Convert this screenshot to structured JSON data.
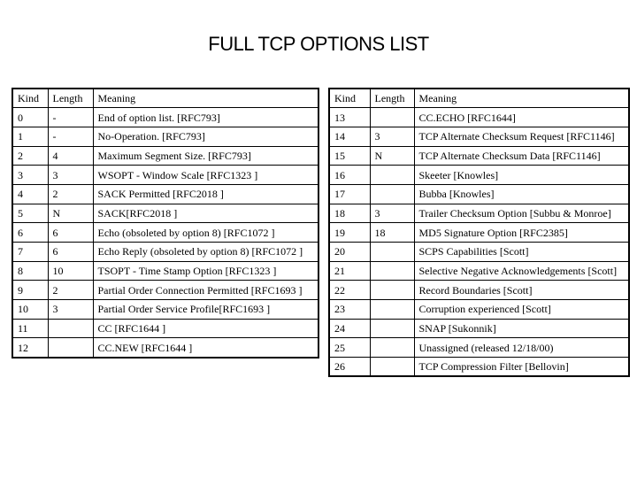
{
  "title": "FULL TCP OPTIONS LIST",
  "headers": {
    "kind": "Kind",
    "length": "Length",
    "meaning": "Meaning"
  },
  "left_table": [
    {
      "kind": "0",
      "length": "-",
      "meaning": "End of option list. [RFC793]"
    },
    {
      "kind": "1",
      "length": "-",
      "meaning": "No-Operation. [RFC793]"
    },
    {
      "kind": "2",
      "length": "4",
      "meaning": "Maximum Segment Size. [RFC793]"
    },
    {
      "kind": "3",
      "length": "3",
      "meaning": "WSOPT - Window Scale [RFC1323 ]"
    },
    {
      "kind": "4",
      "length": "2",
      "meaning": "SACK Permitted [RFC2018 ]"
    },
    {
      "kind": "5",
      "length": "N",
      "meaning": "SACK[RFC2018 ]"
    },
    {
      "kind": "6",
      "length": "6",
      "meaning": "Echo (obsoleted by option 8) [RFC1072 ]"
    },
    {
      "kind": "7",
      "length": "6",
      "meaning": "Echo Reply (obsoleted by option 8) [RFC1072 ]"
    },
    {
      "kind": "8",
      "length": "10",
      "meaning": "TSOPT - Time Stamp Option [RFC1323 ]"
    },
    {
      "kind": "9",
      "length": "2",
      "meaning": "Partial Order Connection Permitted [RFC1693 ]"
    },
    {
      "kind": "10",
      "length": "3",
      "meaning": "Partial Order Service Profile[RFC1693 ]"
    },
    {
      "kind": "11",
      "length": "",
      "meaning": "CC [RFC1644 ]"
    },
    {
      "kind": "12",
      "length": "",
      "meaning": "CC.NEW [RFC1644 ]"
    }
  ],
  "right_table": [
    {
      "kind": "13",
      "length": "",
      "meaning": "CC.ECHO [RFC1644]"
    },
    {
      "kind": "14",
      "length": "3",
      "meaning": "TCP Alternate Checksum Request [RFC1146]"
    },
    {
      "kind": "15",
      "length": "N",
      "meaning": "TCP Alternate Checksum Data [RFC1146]"
    },
    {
      "kind": "16",
      "length": "",
      "meaning": "Skeeter [Knowles]"
    },
    {
      "kind": "17",
      "length": "",
      "meaning": "Bubba [Knowles]"
    },
    {
      "kind": "18",
      "length": "3",
      "meaning": "Trailer Checksum Option [Subbu & Monroe]"
    },
    {
      "kind": "19",
      "length": "18",
      "meaning": "MD5 Signature Option [RFC2385]"
    },
    {
      "kind": "20",
      "length": "",
      "meaning": "SCPS Capabilities [Scott]"
    },
    {
      "kind": "21",
      "length": "",
      "meaning": "Selective Negative Acknowledgements [Scott]"
    },
    {
      "kind": "22",
      "length": "",
      "meaning": "Record Boundaries [Scott]"
    },
    {
      "kind": "23",
      "length": "",
      "meaning": "Corruption experienced [Scott]"
    },
    {
      "kind": "24",
      "length": "",
      "meaning": "SNAP [Sukonnik]"
    },
    {
      "kind": "25",
      "length": "",
      "meaning": "Unassigned (released 12/18/00)"
    },
    {
      "kind": "26",
      "length": "",
      "meaning": "TCP Compression Filter [Bellovin]"
    }
  ]
}
